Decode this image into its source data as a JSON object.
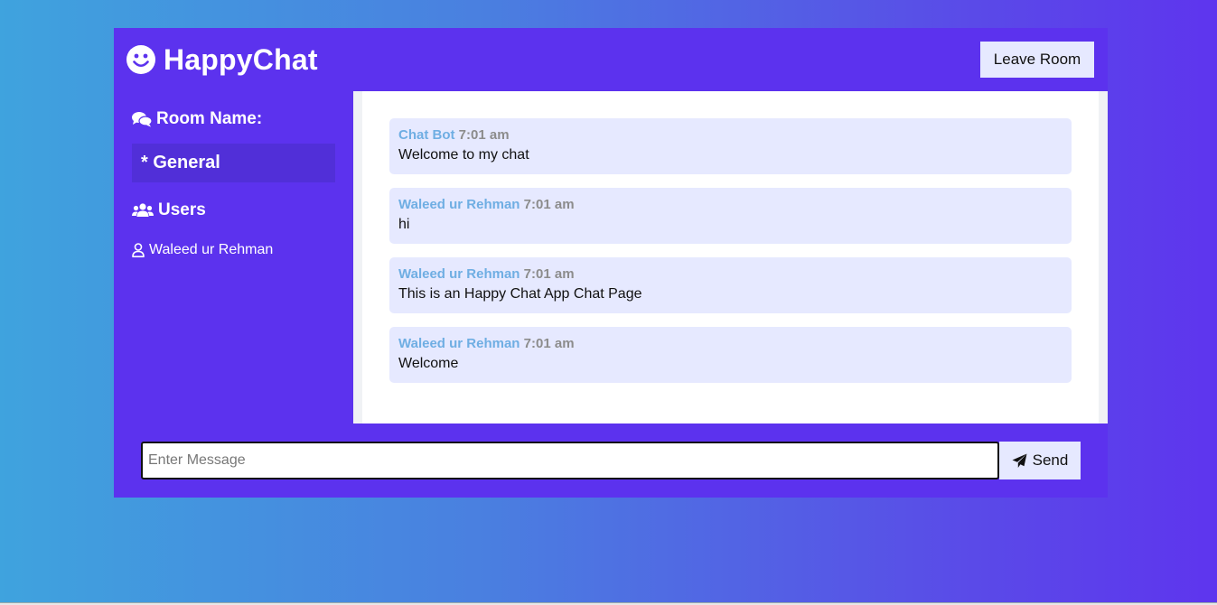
{
  "header": {
    "brand_icon": "smile-icon",
    "title": "HappyChat",
    "leave_label": "Leave Room"
  },
  "sidebar": {
    "room_heading": "Room Name:",
    "room_icon": "comments-icon",
    "room_name": "* General",
    "users_heading": "Users",
    "users_icon": "users-icon",
    "users": [
      {
        "icon": "user-icon",
        "name": "Waleed ur Rehman"
      }
    ]
  },
  "messages": [
    {
      "name": "Chat Bot",
      "time": "7:01 am",
      "text": "Welcome to my chat"
    },
    {
      "name": "Waleed ur Rehman",
      "time": "7:01 am",
      "text": "hi"
    },
    {
      "name": "Waleed ur Rehman",
      "time": "7:01 am",
      "text": "This is an Happy Chat App Chat Page"
    },
    {
      "name": "Waleed ur Rehman",
      "time": "7:01 am",
      "text": "Welcome"
    }
  ],
  "form": {
    "placeholder": "Enter Message",
    "value": "",
    "send_icon": "paper-plane-icon",
    "send_label": "Send"
  },
  "colors": {
    "panel": "#5c32ee",
    "room_highlight": "#512fd8",
    "message_bg": "#e6e9ff",
    "author": "#6faee3",
    "timestamp": "#8c8c8c"
  }
}
